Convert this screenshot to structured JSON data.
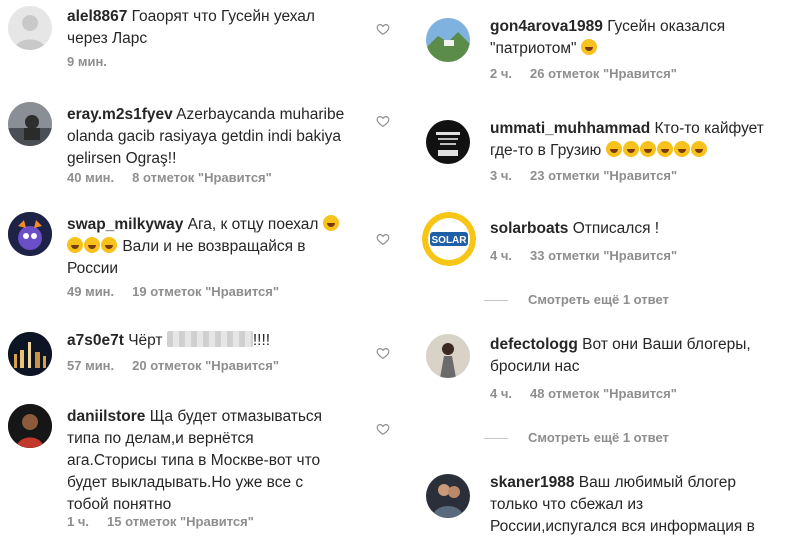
{
  "left": [
    {
      "username": "alel8867",
      "text": "Гоаорят что Гусейн уехал через Ларс",
      "time": "9 мин.",
      "likes": ""
    },
    {
      "username": "eray.m2s1fyev",
      "text": "Azerbaycanda muharibe olanda gacib rasiyaya getdin indi bakiya gelirsen Ograş!!",
      "time": "40 мин.",
      "likes": "8 отметок \"Нравится\""
    },
    {
      "username": "swap_milkyway",
      "text_a": "Ага, к отцу поехал",
      "text_b": "Вали и не возвращайся в России",
      "time": "49 мин.",
      "likes": "19 отметок \"Нравится\""
    },
    {
      "username": "a7s0e7t",
      "text_a": "Чёрт",
      "text_b": "!!!!",
      "time": "57 мин.",
      "likes": "20 отметок \"Нравится\""
    },
    {
      "username": "daniilstore",
      "text": "Ща будет отмазываться типа по делам,и вернётся ага.Сторисы типа в Москве-вот что будет выкладывать.Но уже все с тобой понятно",
      "time": "1 ч.",
      "likes": "15 отметок \"Нравится\""
    }
  ],
  "right": [
    {
      "username": "gon4arova1989",
      "text": "Гусейн оказался \"патриотом\"",
      "time": "2 ч.",
      "likes": "26 отметок \"Нравится\""
    },
    {
      "username": "ummati_muhhammad",
      "text": "Кто-то кайфует где-то в Грузию",
      "time": "3 ч.",
      "likes": "23 отметки \"Нравится\""
    },
    {
      "username": "solarboats",
      "text": "Отписался !",
      "time": "4 ч.",
      "likes": "33 отметки \"Нравится\"",
      "avatar_text": "SOLAR"
    },
    {
      "username": "defectologg",
      "text": "Вот они Ваши блогеры, бросили нас",
      "time": "4 ч.",
      "likes": "48 отметок \"Нравится\""
    },
    {
      "username": "skaner1988",
      "text": "Ваш любимый блогер только что сбежал из России,испугался вся информация в"
    }
  ],
  "replies": {
    "solarboats": "Смотреть ещё 1 ответ",
    "defectologg": "Смотреть ещё 1 ответ"
  },
  "icons": {
    "like": "heart-outline-icon"
  },
  "colors": {
    "text": "#262626",
    "meta": "#8e8e8e",
    "divider": "#c7c7c7"
  }
}
